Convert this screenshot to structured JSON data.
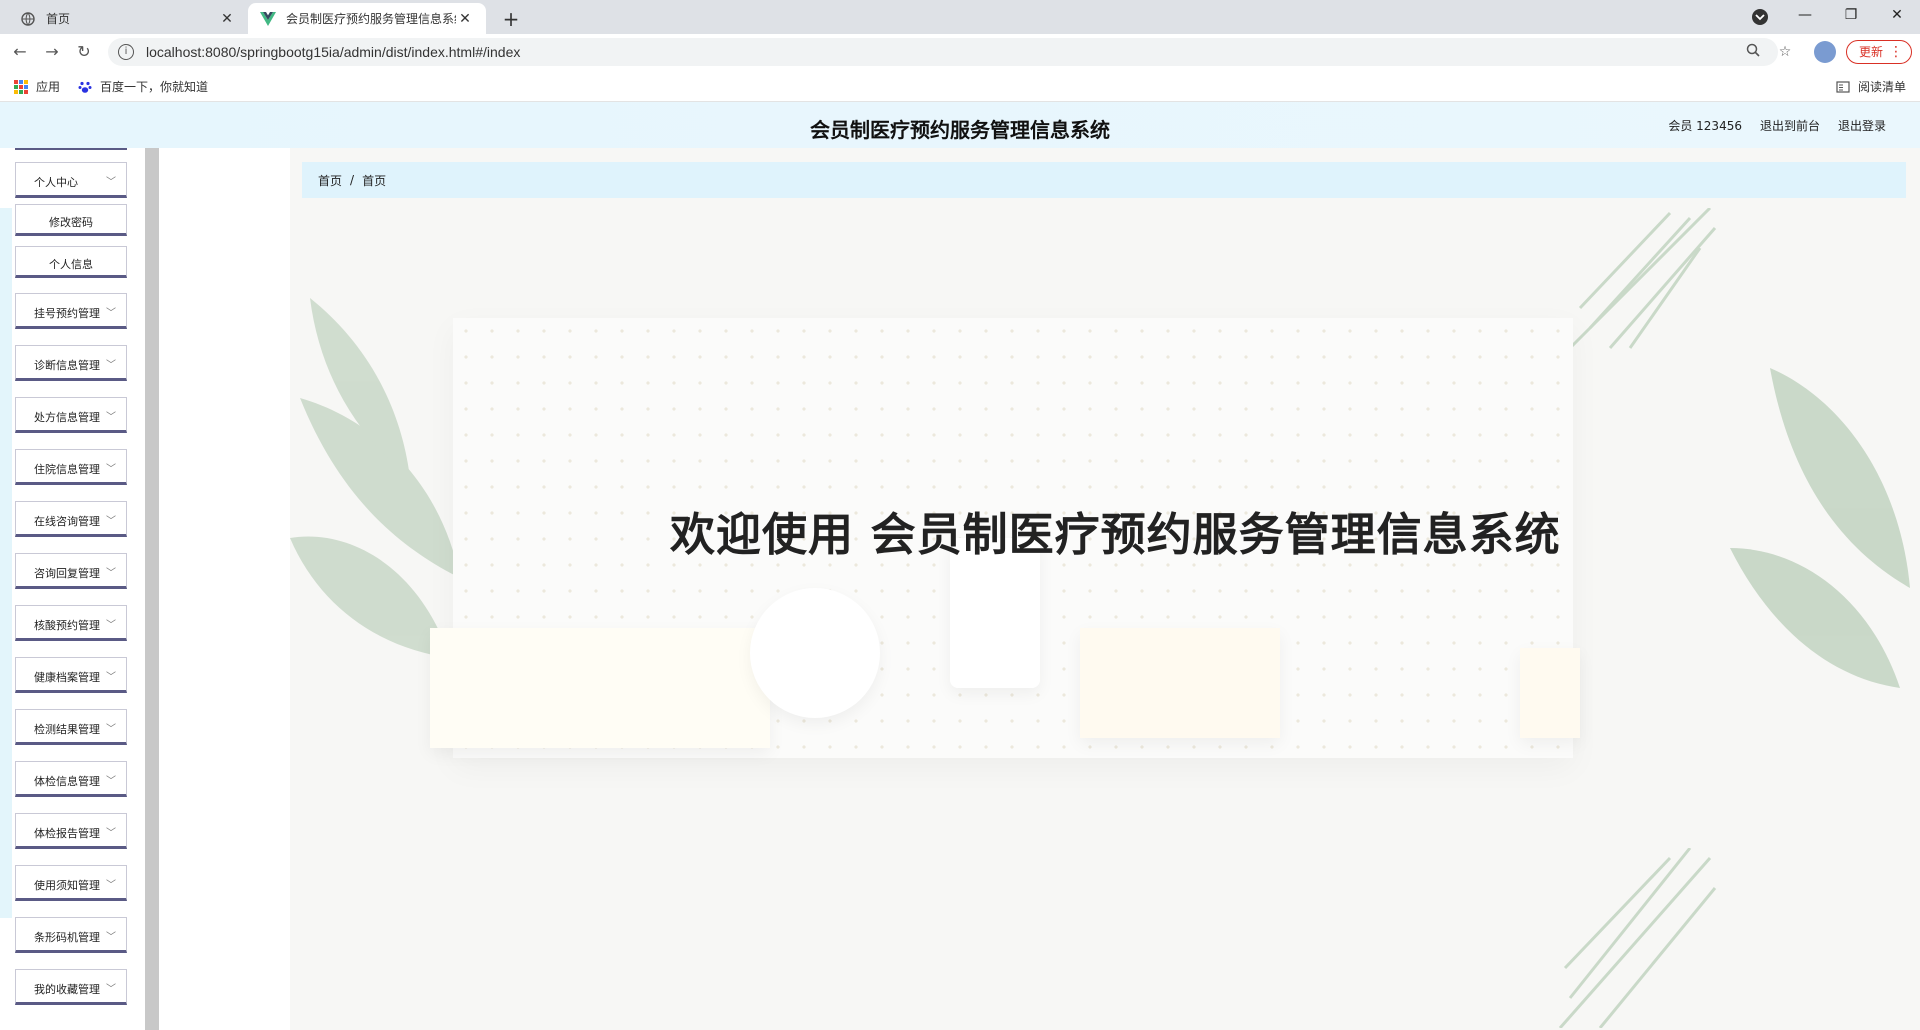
{
  "browser": {
    "tabs": [
      {
        "title": "首页",
        "active": false
      },
      {
        "title": "会员制医疗预约服务管理信息系统",
        "active": true
      }
    ],
    "new_tab_label": "+",
    "url": "localhost:8080/springbootg15ia/admin/dist/index.html#/index",
    "update_label": "更新",
    "bookmarks": [
      {
        "label": "应用"
      },
      {
        "label": "百度一下，你就知道"
      }
    ],
    "reading_list_label": "阅读清单"
  },
  "app": {
    "title": "会员制医疗预约服务管理信息系统",
    "header_links": {
      "user": "会员 123456",
      "to_frontend": "退出到前台",
      "logout": "退出登录"
    },
    "breadcrumb": [
      "首页",
      "首页"
    ],
    "breadcrumb_separator": "/",
    "welcome": "欢迎使用 会员制医疗预约服务管理信息系统"
  },
  "sidebar": {
    "personal_center": "个人中心",
    "sub_items": [
      "修改密码",
      "个人信息"
    ],
    "groups": [
      "挂号预约管理",
      "诊断信息管理",
      "处方信息管理",
      "住院信息管理",
      "在线咨询管理",
      "咨询回复管理",
      "核酸预约管理",
      "健康档案管理",
      "检测结果管理",
      "体检信息管理",
      "体检报告管理",
      "使用须知管理",
      "条形码机管理",
      "我的收藏管理"
    ]
  },
  "colors": {
    "header_bg": "#e6f6fd",
    "breadcrumb_bg": "#dff3fc",
    "menu_border": "#5a5a85",
    "update_red": "#d93025"
  }
}
